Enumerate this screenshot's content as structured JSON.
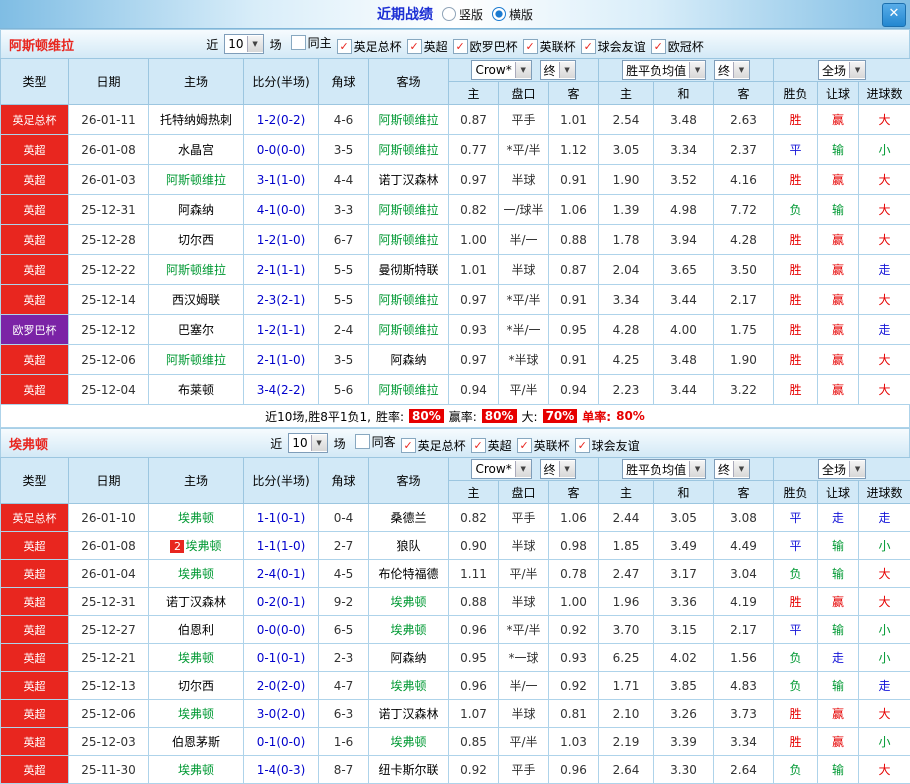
{
  "icons": {
    "dropdown_arrow": "▼",
    "check": "✓",
    "close": "✕"
  },
  "topbar": {
    "title": "近期战绩",
    "radios": [
      {
        "label": "竖版",
        "selected": false
      },
      {
        "label": "横版",
        "selected": true
      }
    ]
  },
  "filter_labels": {
    "near": "近",
    "count": "10",
    "games": "场"
  },
  "columns": {
    "type": "类型",
    "date": "日期",
    "home": "主场",
    "score": "比分(半场)",
    "corner": "角球",
    "away": "客场",
    "ah_select": "Crow*",
    "ah_end": "终",
    "eu_select": "胜平负均值",
    "eu_end": "终",
    "result_select": "全场",
    "sub_ah_home": "主",
    "sub_ah_line": "盘口",
    "sub_ah_away": "客",
    "sub_eu_home": "主",
    "sub_eu_draw": "和",
    "sub_eu_away": "客",
    "sub_wdl": "胜负",
    "sub_handicap": "让球",
    "sub_goals": "进球数"
  },
  "sections": [
    {
      "team": "阿斯顿维拉",
      "filters": [
        {
          "label": "同主",
          "checked": false
        },
        {
          "label": "英足总杯",
          "checked": true
        },
        {
          "label": "英超",
          "checked": true
        },
        {
          "label": "欧罗巴杯",
          "checked": true
        },
        {
          "label": "英联杯",
          "checked": true
        },
        {
          "label": "球会友谊",
          "checked": true
        },
        {
          "label": "欧冠杯",
          "checked": true
        }
      ],
      "rows": [
        {
          "type": "英足总杯",
          "type_color": "red",
          "date": "26-01-11",
          "home": "托特纳姆热刺",
          "home_badge": "",
          "score": "1-2(0-2)",
          "corner": "4-6",
          "away": "阿斯顿维拉",
          "ah_home": "0.87",
          "ah_line": "平手",
          "ah_away": "1.01",
          "eu_home": "2.54",
          "eu_draw": "3.48",
          "eu_away": "2.63",
          "wdl": "胜",
          "handicap": "赢",
          "goals": "大"
        },
        {
          "type": "英超",
          "type_color": "red",
          "date": "26-01-08",
          "home": "水晶宫",
          "home_badge": "",
          "score": "0-0(0-0)",
          "corner": "3-5",
          "away": "阿斯顿维拉",
          "ah_home": "0.77",
          "ah_line": "*平/半",
          "ah_away": "1.12",
          "eu_home": "3.05",
          "eu_draw": "3.34",
          "eu_away": "2.37",
          "wdl": "平",
          "handicap": "输",
          "goals": "小"
        },
        {
          "type": "英超",
          "type_color": "red",
          "date": "26-01-03",
          "home": "阿斯顿维拉",
          "home_badge": "",
          "score": "3-1(1-0)",
          "corner": "4-4",
          "away": "诺丁汉森林",
          "ah_home": "0.97",
          "ah_line": "半球",
          "ah_away": "0.91",
          "eu_home": "1.90",
          "eu_draw": "3.52",
          "eu_away": "4.16",
          "wdl": "胜",
          "handicap": "赢",
          "goals": "大"
        },
        {
          "type": "英超",
          "type_color": "red",
          "date": "25-12-31",
          "home": "阿森纳",
          "home_badge": "",
          "score": "4-1(0-0)",
          "corner": "3-3",
          "away": "阿斯顿维拉",
          "ah_home": "0.82",
          "ah_line": "一/球半",
          "ah_away": "1.06",
          "eu_home": "1.39",
          "eu_draw": "4.98",
          "eu_away": "7.72",
          "wdl": "负",
          "handicap": "输",
          "goals": "大"
        },
        {
          "type": "英超",
          "type_color": "red",
          "date": "25-12-28",
          "home": "切尔西",
          "home_badge": "",
          "score": "1-2(1-0)",
          "corner": "6-7",
          "away": "阿斯顿维拉",
          "ah_home": "1.00",
          "ah_line": "半/一",
          "ah_away": "0.88",
          "eu_home": "1.78",
          "eu_draw": "3.94",
          "eu_away": "4.28",
          "wdl": "胜",
          "handicap": "赢",
          "goals": "大"
        },
        {
          "type": "英超",
          "type_color": "red",
          "date": "25-12-22",
          "home": "阿斯顿维拉",
          "home_badge": "",
          "score": "2-1(1-1)",
          "corner": "5-5",
          "away": "曼彻斯特联",
          "ah_home": "1.01",
          "ah_line": "半球",
          "ah_away": "0.87",
          "eu_home": "2.04",
          "eu_draw": "3.65",
          "eu_away": "3.50",
          "wdl": "胜",
          "handicap": "赢",
          "goals": "走"
        },
        {
          "type": "英超",
          "type_color": "red",
          "date": "25-12-14",
          "home": "西汉姆联",
          "home_badge": "",
          "score": "2-3(2-1)",
          "corner": "5-5",
          "away": "阿斯顿维拉",
          "ah_home": "0.97",
          "ah_line": "*平/半",
          "ah_away": "0.91",
          "eu_home": "3.34",
          "eu_draw": "3.44",
          "eu_away": "2.17",
          "wdl": "胜",
          "handicap": "赢",
          "goals": "大"
        },
        {
          "type": "欧罗巴杯",
          "type_color": "purple",
          "date": "25-12-12",
          "home": "巴塞尔",
          "home_badge": "",
          "score": "1-2(1-1)",
          "corner": "2-4",
          "away": "阿斯顿维拉",
          "ah_home": "0.93",
          "ah_line": "*半/一",
          "ah_away": "0.95",
          "eu_home": "4.28",
          "eu_draw": "4.00",
          "eu_away": "1.75",
          "wdl": "胜",
          "handicap": "赢",
          "goals": "走"
        },
        {
          "type": "英超",
          "type_color": "red",
          "date": "25-12-06",
          "home": "阿斯顿维拉",
          "home_badge": "",
          "score": "2-1(1-0)",
          "corner": "3-5",
          "away": "阿森纳",
          "ah_home": "0.97",
          "ah_line": "*半球",
          "ah_away": "0.91",
          "eu_home": "4.25",
          "eu_draw": "3.48",
          "eu_away": "1.90",
          "wdl": "胜",
          "handicap": "赢",
          "goals": "大"
        },
        {
          "type": "英超",
          "type_color": "red",
          "date": "25-12-04",
          "home": "布莱顿",
          "home_badge": "",
          "score": "3-4(2-2)",
          "corner": "5-6",
          "away": "阿斯顿维拉",
          "ah_home": "0.94",
          "ah_line": "平/半",
          "ah_away": "0.94",
          "eu_home": "2.23",
          "eu_draw": "3.44",
          "eu_away": "3.22",
          "wdl": "胜",
          "handicap": "赢",
          "goals": "大"
        }
      ],
      "summary": {
        "prefix": "近10场,胜8平1负1,",
        "stats": [
          {
            "label": "胜率:",
            "value": "80%",
            "boxed": true
          },
          {
            "label": "赢率:",
            "value": "80%",
            "boxed": true
          },
          {
            "label": "大:",
            "value": "70%",
            "boxed": true
          },
          {
            "label": "单率:",
            "value": "80%",
            "boxed": false
          }
        ]
      }
    },
    {
      "team": "埃弗顿",
      "filters": [
        {
          "label": "同客",
          "checked": false
        },
        {
          "label": "英足总杯",
          "checked": true
        },
        {
          "label": "英超",
          "checked": true
        },
        {
          "label": "英联杯",
          "checked": true
        },
        {
          "label": "球会友谊",
          "checked": true
        }
      ],
      "rows": [
        {
          "type": "英足总杯",
          "type_color": "red",
          "date": "26-01-10",
          "home": "埃弗顿",
          "home_badge": "",
          "score": "1-1(0-1)",
          "corner": "0-4",
          "away": "桑德兰",
          "ah_home": "0.82",
          "ah_line": "平手",
          "ah_away": "1.06",
          "eu_home": "2.44",
          "eu_draw": "3.05",
          "eu_away": "3.08",
          "wdl": "平",
          "handicap": "走",
          "goals": "走"
        },
        {
          "type": "英超",
          "type_color": "red",
          "date": "26-01-08",
          "home": "埃弗顿",
          "home_badge": "2",
          "score": "1-1(1-0)",
          "corner": "2-7",
          "away": "狼队",
          "ah_home": "0.90",
          "ah_line": "半球",
          "ah_away": "0.98",
          "eu_home": "1.85",
          "eu_draw": "3.49",
          "eu_away": "4.49",
          "wdl": "平",
          "handicap": "输",
          "goals": "小"
        },
        {
          "type": "英超",
          "type_color": "red",
          "date": "26-01-04",
          "home": "埃弗顿",
          "home_badge": "",
          "score": "2-4(0-1)",
          "corner": "4-5",
          "away": "布伦特福德",
          "ah_home": "1.11",
          "ah_line": "平/半",
          "ah_away": "0.78",
          "eu_home": "2.47",
          "eu_draw": "3.17",
          "eu_away": "3.04",
          "wdl": "负",
          "handicap": "输",
          "goals": "大"
        },
        {
          "type": "英超",
          "type_color": "red",
          "date": "25-12-31",
          "home": "诺丁汉森林",
          "home_badge": "",
          "score": "0-2(0-1)",
          "corner": "9-2",
          "away": "埃弗顿",
          "ah_home": "0.88",
          "ah_line": "半球",
          "ah_away": "1.00",
          "eu_home": "1.96",
          "eu_draw": "3.36",
          "eu_away": "4.19",
          "wdl": "胜",
          "handicap": "赢",
          "goals": "大"
        },
        {
          "type": "英超",
          "type_color": "red",
          "date": "25-12-27",
          "home": "伯恩利",
          "home_badge": "",
          "score": "0-0(0-0)",
          "corner": "6-5",
          "away": "埃弗顿",
          "ah_home": "0.96",
          "ah_line": "*平/半",
          "ah_away": "0.92",
          "eu_home": "3.70",
          "eu_draw": "3.15",
          "eu_away": "2.17",
          "wdl": "平",
          "handicap": "输",
          "goals": "小"
        },
        {
          "type": "英超",
          "type_color": "red",
          "date": "25-12-21",
          "home": "埃弗顿",
          "home_badge": "",
          "score": "0-1(0-1)",
          "corner": "2-3",
          "away": "阿森纳",
          "ah_home": "0.95",
          "ah_line": "*一球",
          "ah_away": "0.93",
          "eu_home": "6.25",
          "eu_draw": "4.02",
          "eu_away": "1.56",
          "wdl": "负",
          "handicap": "走",
          "goals": "小"
        },
        {
          "type": "英超",
          "type_color": "red",
          "date": "25-12-13",
          "home": "切尔西",
          "home_badge": "",
          "score": "2-0(2-0)",
          "corner": "4-7",
          "away": "埃弗顿",
          "ah_home": "0.96",
          "ah_line": "半/一",
          "ah_away": "0.92",
          "eu_home": "1.71",
          "eu_draw": "3.85",
          "eu_away": "4.83",
          "wdl": "负",
          "handicap": "输",
          "goals": "走"
        },
        {
          "type": "英超",
          "type_color": "red",
          "date": "25-12-06",
          "home": "埃弗顿",
          "home_badge": "",
          "score": "3-0(2-0)",
          "corner": "6-3",
          "away": "诺丁汉森林",
          "ah_home": "1.07",
          "ah_line": "半球",
          "ah_away": "0.81",
          "eu_home": "2.10",
          "eu_draw": "3.26",
          "eu_away": "3.73",
          "wdl": "胜",
          "handicap": "赢",
          "goals": "大"
        },
        {
          "type": "英超",
          "type_color": "red",
          "date": "25-12-03",
          "home": "伯恩茅斯",
          "home_badge": "",
          "score": "0-1(0-0)",
          "corner": "1-6",
          "away": "埃弗顿",
          "ah_home": "0.85",
          "ah_line": "平/半",
          "ah_away": "1.03",
          "eu_home": "2.19",
          "eu_draw": "3.39",
          "eu_away": "3.34",
          "wdl": "胜",
          "handicap": "赢",
          "goals": "小"
        },
        {
          "type": "英超",
          "type_color": "red",
          "date": "25-11-30",
          "home": "埃弗顿",
          "home_badge": "",
          "score": "1-4(0-3)",
          "corner": "8-7",
          "away": "纽卡斯尔联",
          "ah_home": "0.92",
          "ah_line": "平手",
          "ah_away": "0.96",
          "eu_home": "2.64",
          "eu_draw": "3.30",
          "eu_away": "2.64",
          "wdl": "负",
          "handicap": "输",
          "goals": "大"
        }
      ]
    }
  ]
}
